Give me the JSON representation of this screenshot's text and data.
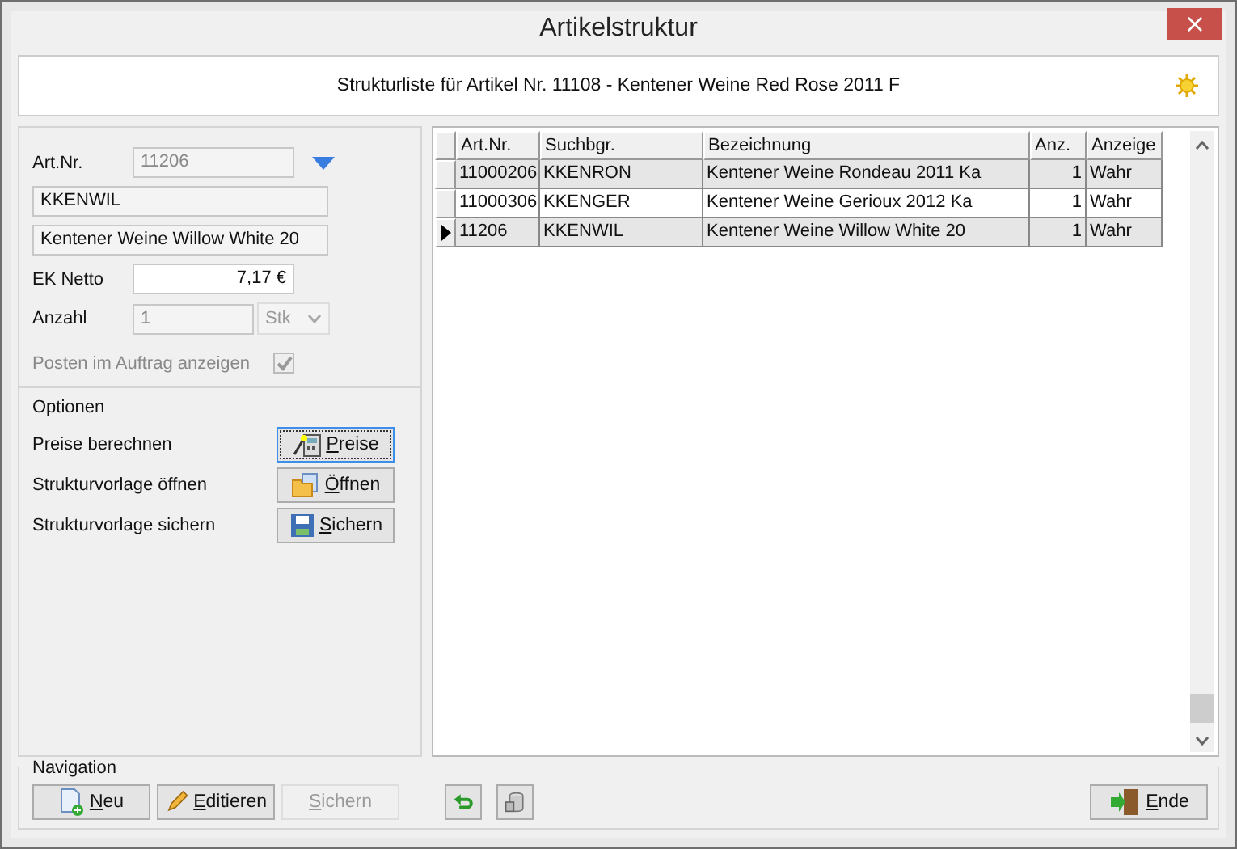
{
  "window": {
    "title": "Artikelstruktur",
    "close": "×"
  },
  "header": {
    "text": "Strukturliste für Artikel Nr. 11108 - Kentener Weine Red Rose 2011 F"
  },
  "form": {
    "art_nr_label": "Art.Nr.",
    "art_nr": "11206",
    "art_nr_disabled": true,
    "search_term": "KKENWIL",
    "description": "Kentener Weine Willow White 20",
    "ek_label": "EK Netto",
    "ek_value": "7,17 €",
    "anzahl_label": "Anzahl",
    "anzahl": "1",
    "unit": "Stk",
    "anzahl_disabled": true,
    "show_label": "Posten im Auftrag anzeigen",
    "show_checked": true,
    "show_disabled": true
  },
  "options": {
    "title": "Optionen",
    "rows": [
      {
        "label": "Preise berechnen",
        "button": "Preise",
        "kind": "calc",
        "focused": true
      },
      {
        "label": "Strukturvorlage öffnen",
        "button": "Öffnen",
        "kind": "open",
        "focused": false
      },
      {
        "label": "Strukturvorlage sichern",
        "button": "Sichern",
        "kind": "save",
        "focused": false
      }
    ]
  },
  "table": {
    "columns": [
      "Art.Nr.",
      "Suchbgr.",
      "Bezeichnung",
      "Anz.",
      "Anzeige"
    ],
    "rows": [
      {
        "cells": [
          "11000206",
          "KKENRON",
          "Kentener Weine Rondeau 2011 Ka",
          "1",
          "Wahr"
        ],
        "selected": false
      },
      {
        "cells": [
          "11000306",
          "KKENGER",
          "Kentener Weine Gerioux 2012 Ka",
          "1",
          "Wahr"
        ],
        "selected": false
      },
      {
        "cells": [
          "11206",
          "KKENWIL",
          "Kentener Weine Willow White 20",
          "1",
          "Wahr"
        ],
        "selected": true
      }
    ]
  },
  "navigation": {
    "title": "Navigation",
    "buttons": [
      {
        "label": "Neu",
        "kind": "new",
        "disabled": false
      },
      {
        "label": "Editieren",
        "kind": "edit",
        "disabled": false
      },
      {
        "label": "Sichern",
        "kind": "plain",
        "disabled": true
      },
      {
        "kind": "undo",
        "disabled": false
      },
      {
        "kind": "db",
        "disabled": false
      },
      {
        "label": "Ende",
        "kind": "exit",
        "disabled": false
      }
    ]
  }
}
